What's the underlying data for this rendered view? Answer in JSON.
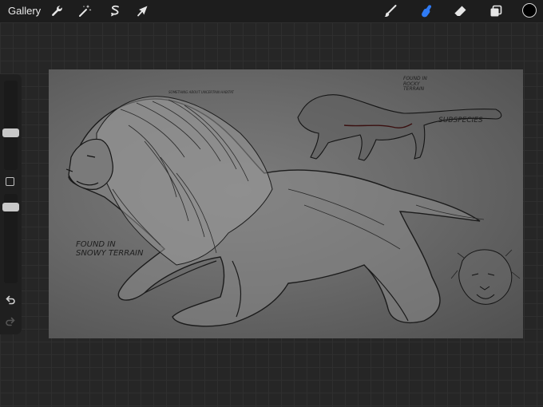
{
  "topbar": {
    "gallery_label": "Gallery",
    "tools_left": [
      {
        "name": "actions",
        "icon": "wrench-icon"
      },
      {
        "name": "adjustments",
        "icon": "magic-wand-icon"
      },
      {
        "name": "selection",
        "icon": "selection-s-icon"
      },
      {
        "name": "transform",
        "icon": "arrow-cursor-icon"
      }
    ],
    "tools_right": [
      {
        "name": "brush",
        "icon": "brush-icon",
        "active": false
      },
      {
        "name": "smudge",
        "icon": "smudge-finger-icon",
        "active": true
      },
      {
        "name": "eraser",
        "icon": "eraser-icon",
        "active": false
      },
      {
        "name": "layers",
        "icon": "layers-icon",
        "active": false
      }
    ],
    "current_color": "#000000",
    "active_color": "#2f7bf5"
  },
  "sidebar": {
    "brush_size_level": 0.3,
    "opacity_level": 0.6
  },
  "canvas": {
    "notes": {
      "top_tiny": "SOMETHING ABOUT UNCERTAIN HABITAT",
      "top_right": "FOUND IN\nROCKY\nTERRAIN",
      "subspecies": "SUBSPECIES",
      "left_middle": "FOUND IN\nSNOWY TERRAIN"
    }
  }
}
